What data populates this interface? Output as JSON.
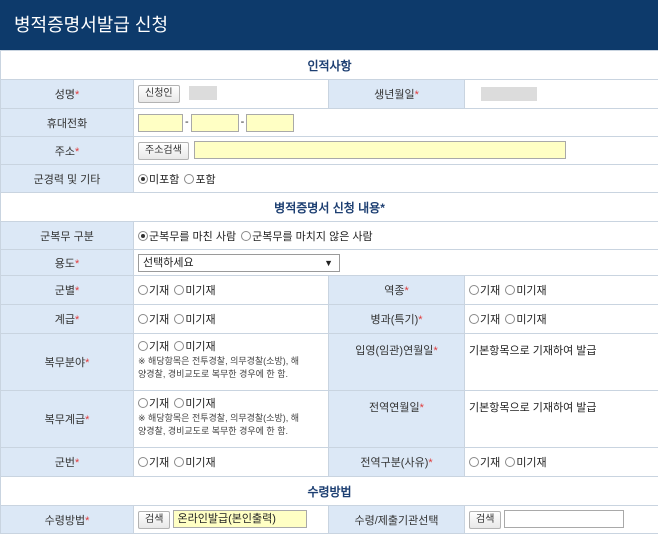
{
  "title": "병적증명서발급 신청",
  "sections": {
    "personal": "인적사항",
    "application": "병적증명서 신청 내용",
    "application_req": "*",
    "receipt": "수령방법"
  },
  "req_mark": "*",
  "personal": {
    "name_label": "성명",
    "applicant_button": "신청인",
    "birth_label": "생년월일",
    "phone_label": "휴대전화",
    "phone_sep": "-",
    "address_label": "주소",
    "address_search_button": "주소검색",
    "military_label": "군경력 및 기타",
    "military_opts": [
      "미포함",
      "포함"
    ]
  },
  "application": {
    "service_type_label": "군복무 구분",
    "service_type_opts": [
      "군복무를 마친 사람",
      "군복무를 마치지 않은 사람"
    ],
    "purpose_label": "용도",
    "purpose_select": "선택하세요",
    "branch_label": "군별",
    "enlist_type_label": "역종",
    "rank_label": "계급",
    "specialty_label": "병과(특기)",
    "service_field_label": "복무분야",
    "enlist_date_label": "입영(임관)연월일",
    "service_rank_label": "복무계급",
    "discharge_date_label": "전역연월일",
    "serial_label": "군번",
    "discharge_type_label": "전역구분(사유)",
    "opt_record": "기재",
    "opt_norecord": "미기재",
    "note_line1": "※ 해당항목은 전투경찰, 의무경찰(소방), 해",
    "note_line2": "양경찰, 경비교도로 복무한 경우에 한 함.",
    "default_text": "기본항목으로 기재하여 발급"
  },
  "receipt": {
    "method_label": "수령방법",
    "search_button": "검색",
    "method_value": "온라인발급(본인출력)",
    "agency_label": "수령/제출기관선택",
    "agency_search_button": "검색"
  }
}
